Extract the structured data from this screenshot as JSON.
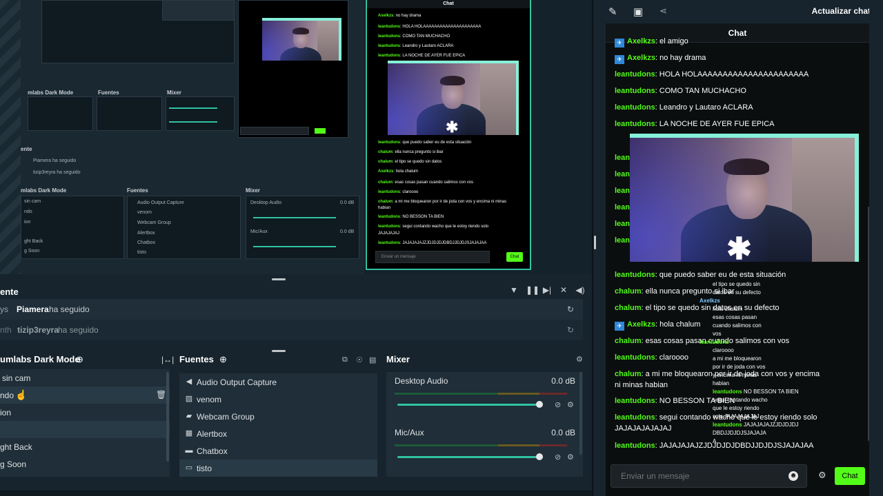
{
  "header": {
    "refresh_label": "Actualizar chat"
  },
  "activity": {
    "title": "ente",
    "events": [
      {
        "prefix": "ys",
        "user": "Piamera",
        "text": "ha seguido"
      },
      {
        "prefix": "nth",
        "user": "tizip3reyra",
        "text": "ha seguido"
      }
    ]
  },
  "scenes": {
    "title": "umlabs Dark Mode",
    "items": [
      "sin cam",
      "ndo",
      "ion",
      "",
      "ght Back",
      "g Soon"
    ]
  },
  "sources": {
    "title": "Fuentes",
    "items": [
      {
        "label": "Audio Output Capture",
        "icon": "speaker-icon"
      },
      {
        "label": "venom",
        "icon": "image-icon"
      },
      {
        "label": "Webcam Group",
        "icon": "folder-icon"
      },
      {
        "label": "Alertbox",
        "icon": "browser-icon"
      },
      {
        "label": "Chatbox",
        "icon": "chat-icon"
      },
      {
        "label": "tisto",
        "icon": "monitor-icon"
      }
    ]
  },
  "mixer": {
    "title": "Mixer",
    "channels": [
      {
        "name": "Desktop Audio",
        "db": "0.0 dB"
      },
      {
        "name": "Mic/Aux",
        "db": "0.0 dB"
      }
    ]
  },
  "chat": {
    "title": "Chat",
    "input_placeholder": "Enviar un mensaje",
    "send_label": "Chat",
    "messages": [
      {
        "user": "Axelkzs",
        "text": "el amigo",
        "badge": true
      },
      {
        "user": "Axelkzs",
        "text": "no hay drama",
        "badge": true
      },
      {
        "user": "leantudons",
        "text": "HOLA HOLAAAAAAAAAAAAAAAAAAAAAA"
      },
      {
        "user": "leantudons",
        "text": "COMO TAN MUCHACHO"
      },
      {
        "user": "leantudons",
        "text": "Leandro y Lautaro ACLARA"
      },
      {
        "user": "leantudons",
        "text": "LA NOCHE DE AYER FUE EPICA"
      },
      {
        "user": "leantudons",
        "text": "que puedo saber eu de esta situación"
      },
      {
        "user": "chalum",
        "text": "ella nunca pregunto si ibar"
      },
      {
        "user": "chalum",
        "text": "el tipo se quedo sin datos en su defecto"
      },
      {
        "user": "Axelkzs",
        "text": "hola chalum",
        "badge": true
      },
      {
        "user": "chalum",
        "text": "esas cosas pasan cuando salimos con vos"
      },
      {
        "user": "leantudons",
        "text": "claroooo"
      },
      {
        "user": "chalum",
        "text": "a mi me bloquearon por ir de joda con vos y encima ni minas habian"
      },
      {
        "user": "leantudons",
        "text": "NO BESSON TA BIEN"
      },
      {
        "user": "leantudons",
        "text": "segui contando wacho que le estoy riendo solo JAJAJAJAJAJAJ"
      },
      {
        "user": "leantudons",
        "text": "JAJAJAJAJZJDJDJDJDBDJJDJDJSJAJAJAA"
      }
    ],
    "overlay_lines": [
      {
        "user": "",
        "text": "el tipo se quedo sin"
      },
      {
        "user": "",
        "text": "datos en su defecto"
      },
      {
        "user": "Axelkzs",
        "text": ""
      },
      {
        "user": "",
        "text": "hola chalum"
      },
      {
        "user": "",
        "text": "esas cosas pasan"
      },
      {
        "user": "",
        "text": "cuando salimos con"
      },
      {
        "user": "",
        "text": "vos"
      },
      {
        "user": "leantudons",
        "text": ""
      },
      {
        "user": "",
        "text": "claroooo"
      },
      {
        "user": "",
        "text": "a mi me bloquearon"
      },
      {
        "user": "",
        "text": "por ir de joda con vos"
      },
      {
        "user": "",
        "text": "y encima ni minas"
      },
      {
        "user": "",
        "text": "habian"
      },
      {
        "user": "leantudons",
        "text": "NO BESSON TA BIEN"
      },
      {
        "user": "",
        "text": "segui contando wacho"
      },
      {
        "user": "",
        "text": "que le estoy riendo"
      },
      {
        "user": "",
        "text": "solo JAJAJAJAJAJ"
      },
      {
        "user": "leantudons",
        "text": "JAJAJAJAJZJDJDJDJ"
      },
      {
        "user": "",
        "text": "DBDJJDJDJSJAJAJA"
      },
      {
        "user": "",
        "text": "A"
      }
    ]
  },
  "preview": {
    "chat_title": "Chat",
    "input_placeholder": "Enviar un mensaje",
    "send_label": "Chat",
    "nested_scenes_title": "mlabs Dark Mode",
    "nested_sources_title": "Fuentes",
    "nested_mixer_title": "Mixer",
    "nested_activity_title": "ente",
    "nested_events": [
      "Piamera ha seguido",
      "tizip3reyra ha seguido"
    ],
    "nested_sources": [
      "Audio Output Capture",
      "venom",
      "Webcam Group",
      "Alertbox",
      "Chatbox",
      "tisto"
    ],
    "nested_scenes": [
      "sin cam",
      "ndo",
      "ion",
      "ght Back",
      "g Soon"
    ],
    "nested_mixer": [
      {
        "name": "Desktop Audio",
        "db": "0.0 dB"
      },
      {
        "name": "Mic/Aux",
        "db": "0.0 dB"
      }
    ],
    "stream_lines": [
      {
        "user": "Axelkzs",
        "text": "no hay drama"
      },
      {
        "user": "leantudons",
        "text": "HOLA HOLAAAAAAAAAAAAAAAAAAAAA"
      },
      {
        "user": "leantudons",
        "text": "COMO TAN MUCHACHO"
      },
      {
        "user": "leantudons",
        "text": "Leandro y Lautaro ACLARA"
      },
      {
        "user": "leantudons",
        "text": "LA NOCHE DE AYER FUE EPICA"
      },
      {
        "user": "leantudons",
        "text": "que puedo saber eu de esta situación"
      },
      {
        "user": "chalum",
        "text": "ella nunca pregunto si ibar"
      },
      {
        "user": "chalum",
        "text": "el tipo se quedo sin datos"
      },
      {
        "user": "Axelkzs",
        "text": "hola chalum"
      },
      {
        "user": "chalum",
        "text": "esas cosas pasan cuando salimos con vos"
      },
      {
        "user": "leantudons",
        "text": "claroooo"
      },
      {
        "user": "chalum",
        "text": "a mi me bloquearon por ir de joda con vos y encima ni minas"
      },
      {
        "user": "",
        "text": "habian"
      },
      {
        "user": "leantudons",
        "text": "NO BESSON TA BIEN"
      },
      {
        "user": "leantudons",
        "text": "segui contando wacho que le estoy riendo solo"
      },
      {
        "user": "",
        "text": "JAJAJAJAJ"
      },
      {
        "user": "leantudons",
        "text": "JAJAJAJAJZJDJDJDJDBDJJDJDJSJAJAJAA"
      }
    ]
  },
  "colors": {
    "accent": "#53fc18",
    "teal": "#31c3a2",
    "panel": "#1f2e38",
    "background": "#17242d"
  }
}
